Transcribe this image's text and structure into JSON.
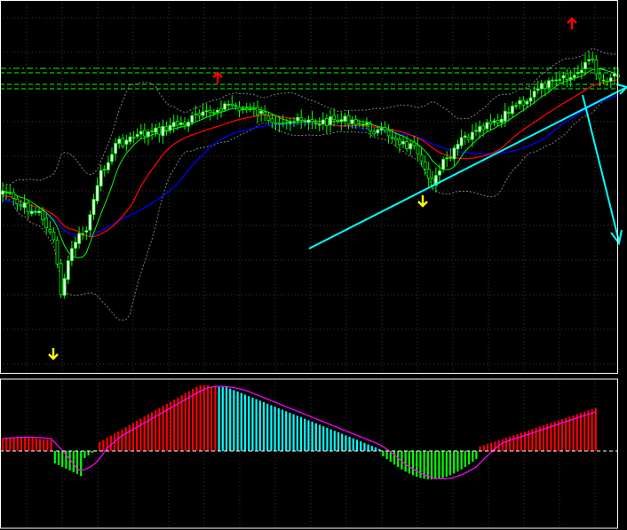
{
  "chart_data": [
    {
      "type": "candlestick",
      "title": "",
      "grid": true,
      "indicators": [
        "moving-average-green",
        "moving-average-red",
        "moving-average-blue",
        "bollinger-bands"
      ],
      "horizontal_levels": [
        "dash-dot-upper",
        "dashed-lower"
      ],
      "annotations": [
        {
          "name": "up-arrow",
          "color": "#ffff00",
          "candle": 15
        },
        {
          "name": "down-arrow",
          "color": "#ff0000",
          "candle": 60
        },
        {
          "name": "up-arrow",
          "color": "#ffff00",
          "candle": 118
        },
        {
          "name": "down-arrow",
          "color": "#ff0000",
          "candle": 161
        }
      ],
      "trendlines": [
        "support-trendline",
        "projection-arrow"
      ],
      "colors": {
        "background": "#000000",
        "bull_candle": "#ffffff",
        "bear_candle": "#000000",
        "candle_outline": "#00ff00",
        "ma_green": "#00ff00",
        "ma_red": "#ff0000",
        "ma_blue": "#0000ff",
        "bands": "#808080",
        "trendline": "#00ffff",
        "level_lines": "#00ff00",
        "grid": "#3a3a3a"
      }
    },
    {
      "type": "bar",
      "indicator": "oscillator-histogram-with-signal",
      "colors": {
        "rising_positive": "#ff0000",
        "falling_positive": "#00ffff",
        "negative": "#00ff00",
        "signal": "#ff00ff",
        "zero_line": "#ffffff"
      }
    }
  ]
}
